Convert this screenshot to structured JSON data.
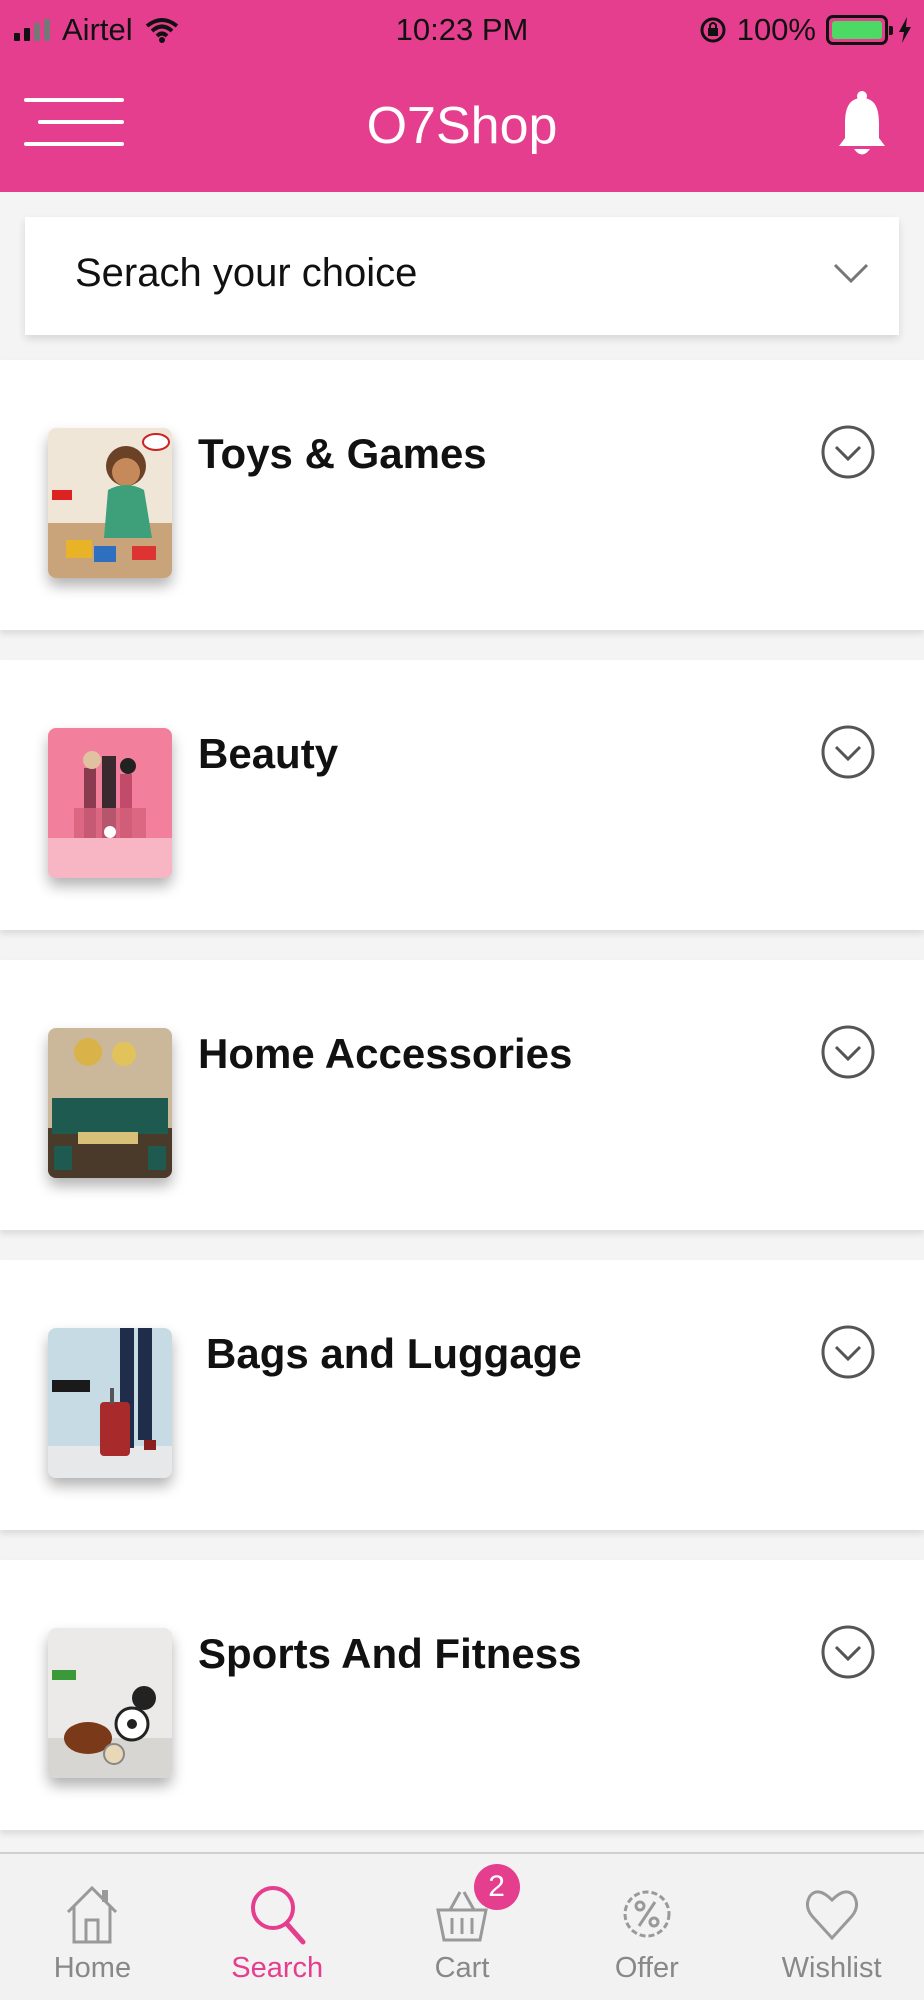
{
  "status_bar": {
    "carrier": "Airtel",
    "time": "10:23 PM",
    "battery": "100%"
  },
  "nav": {
    "title": "O7Shop",
    "menu_icon": "menu-icon",
    "bell_icon": "bell-icon"
  },
  "search": {
    "placeholder": "Serach your choice",
    "icon": "chevron-down-icon"
  },
  "categories": [
    {
      "label": "Toys & Games"
    },
    {
      "label": "Beauty"
    },
    {
      "label": "Home Accessories"
    },
    {
      "label": "Bags and Luggage"
    },
    {
      "label": "Sports And Fitness"
    }
  ],
  "tabs": [
    {
      "label": "Home",
      "icon": "home-icon"
    },
    {
      "label": "Search",
      "icon": "search-icon",
      "active": true
    },
    {
      "label": "Cart",
      "icon": "basket-icon",
      "badge": "2"
    },
    {
      "label": "Offer",
      "icon": "percent-badge-icon"
    },
    {
      "label": "Wishlist",
      "icon": "heart-icon"
    }
  ],
  "colors": {
    "brand": "#e63e8f",
    "battery": "#4cd964",
    "inactive_tab": "#888888"
  }
}
